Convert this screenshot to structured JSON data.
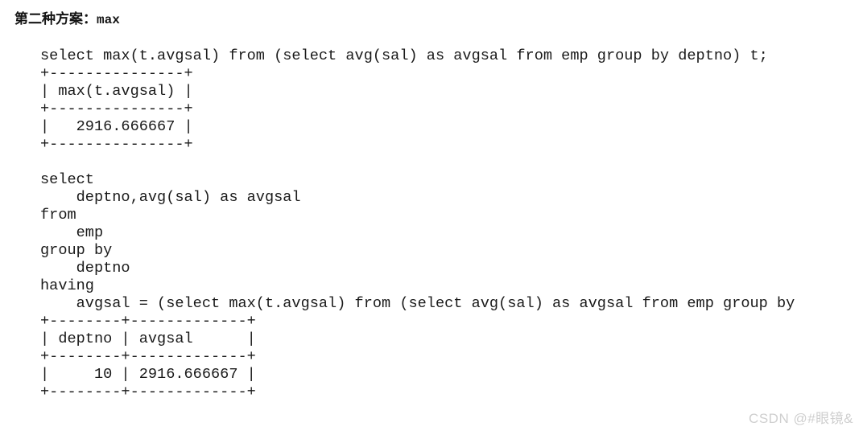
{
  "heading": {
    "prefix": "第二种方案：",
    "keyword": "max"
  },
  "code_block": {
    "lines": [
      "select max(t.avgsal) from (select avg(sal) as avgsal from emp group by deptno) t;",
      "+---------------+",
      "| max(t.avgsal) |",
      "+---------------+",
      "|   2916.666667 |",
      "+---------------+",
      "",
      "select",
      "    deptno,avg(sal) as avgsal",
      "from",
      "    emp",
      "group by",
      "    deptno",
      "having",
      "    avgsal = (select max(t.avgsal) from (select avg(sal) as avgsal from emp group by",
      "+--------+-------------+",
      "| deptno | avgsal      |",
      "+--------+-------------+",
      "|     10 | 2916.666667 |",
      "+--------+-------------+"
    ]
  },
  "queries": {
    "first": {
      "sql": "select max(t.avgsal) from (select avg(sal) as avgsal from emp group by deptno) t;",
      "result": {
        "columns": [
          "max(t.avgsal)"
        ],
        "rows": [
          [
            "2916.666667"
          ]
        ]
      }
    },
    "second": {
      "sql_lines": [
        "select",
        "    deptno,avg(sal) as avgsal",
        "from",
        "    emp",
        "group by",
        "    deptno",
        "having",
        "    avgsal = (select max(t.avgsal) from (select avg(sal) as avgsal from emp group by"
      ],
      "result": {
        "columns": [
          "deptno",
          "avgsal"
        ],
        "rows": [
          [
            "10",
            "2916.666667"
          ]
        ]
      }
    }
  },
  "watermark": {
    "text": "CSDN @#眼镜&",
    "color": "#cfcfcf"
  },
  "colors": {
    "background": "#ffffff",
    "text": "#1a1a1a",
    "heading": "#141414"
  }
}
